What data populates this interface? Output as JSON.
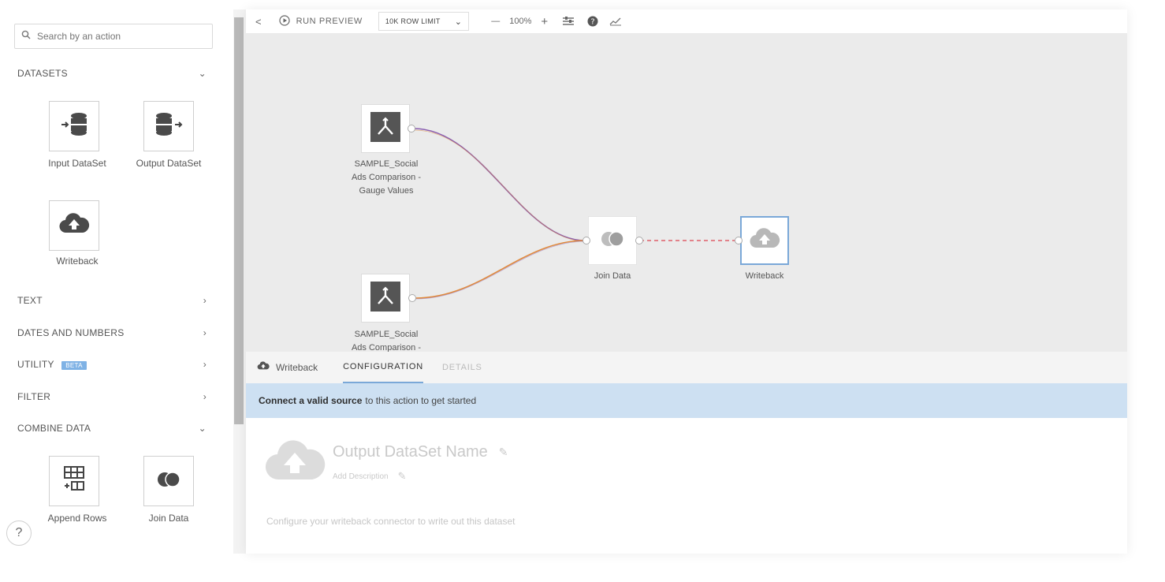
{
  "sidebar": {
    "search_placeholder": "Search by an action",
    "sections": {
      "datasets": "DATASETS",
      "text": "TEXT",
      "dates_numbers": "DATES AND NUMBERS",
      "utility": "UTILITY",
      "utility_badge": "BETA",
      "filter": "FILTER",
      "combine": "COMBINE DATA"
    },
    "tiles": {
      "input_dataset": "Input DataSet",
      "output_dataset": "Output DataSet",
      "writeback": "Writeback",
      "append_rows": "Append Rows",
      "join_data": "Join Data"
    },
    "help": "?"
  },
  "toolbar": {
    "back": "<",
    "run_preview": "RUN PREVIEW",
    "row_limit": "10K ROW LIMIT",
    "zoom_out": "—",
    "zoom": "100%",
    "zoom_in": "+"
  },
  "canvas": {
    "node1_label_l1": "SAMPLE_Social",
    "node1_label_l2": "Ads Comparison -",
    "node1_label_l3": "Gauge Values",
    "node2_label_l1": "SAMPLE_Social",
    "node2_label_l2": "Ads Comparison -",
    "join_label": "Join Data",
    "writeback_label": "Writeback"
  },
  "panel": {
    "tab_writeback": "Writeback",
    "tab_configuration": "CONFIGURATION",
    "tab_details": "DETAILS",
    "notice_bold": "Connect a valid source",
    "notice_rest": "to this action to get started",
    "output_name": "Output DataSet Name",
    "add_description": "Add Description",
    "configure_text": "Configure your writeback connector to write out this dataset"
  },
  "colors": {
    "accent": "#7fb2e5",
    "notice_bg": "#cde0f2",
    "canvas_bg": "#ebebeb",
    "link_purple": "#8a5fb0",
    "link_orange": "#e08a3c",
    "link_red": "#e0606a"
  }
}
